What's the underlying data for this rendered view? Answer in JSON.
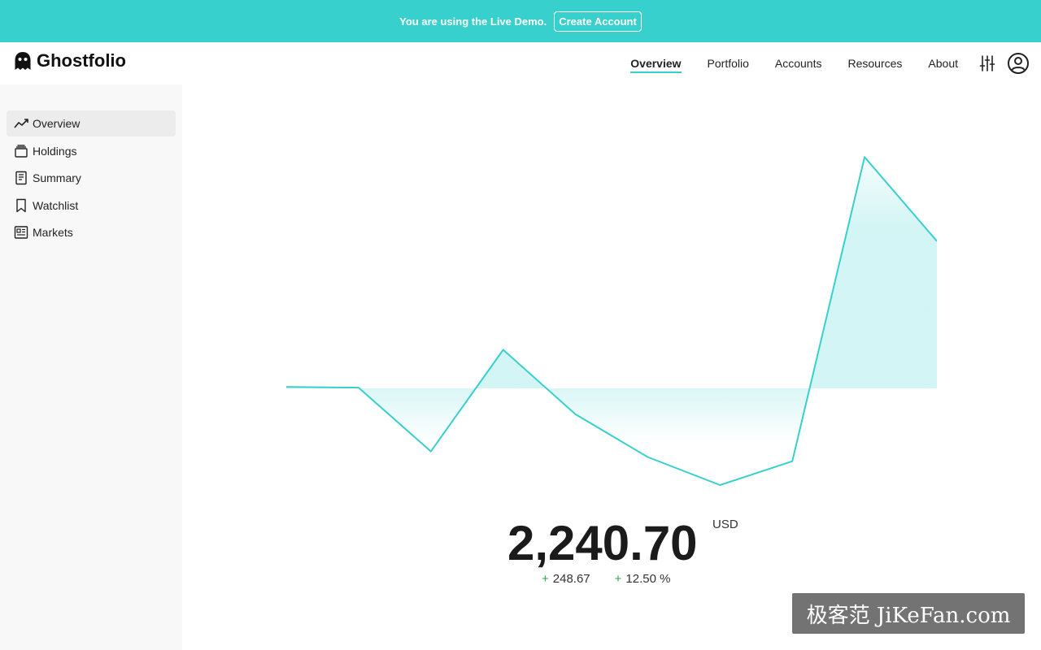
{
  "banner": {
    "text": "You are using the Live Demo.",
    "button_label": "Create Account"
  },
  "brand": {
    "name": "Ghostfolio"
  },
  "nav": {
    "items": [
      {
        "label": "Overview",
        "active": true
      },
      {
        "label": "Portfolio"
      },
      {
        "label": "Accounts"
      },
      {
        "label": "Resources"
      },
      {
        "label": "About"
      }
    ]
  },
  "sidebar": {
    "items": [
      {
        "label": "Overview",
        "icon": "trend-icon",
        "active": true
      },
      {
        "label": "Holdings",
        "icon": "holdings-icon"
      },
      {
        "label": "Summary",
        "icon": "document-icon"
      },
      {
        "label": "Watchlist",
        "icon": "bookmark-icon"
      },
      {
        "label": "Markets",
        "icon": "newspaper-icon"
      }
    ]
  },
  "performance": {
    "value": "2,240.70",
    "currency": "USD",
    "change_abs": "248.67",
    "change_pct": "12.50 %",
    "change_sign": "+"
  },
  "chart_data": {
    "type": "area",
    "values": [
      0.02,
      0.01,
      -0.9,
      0.55,
      -0.37,
      -0.98,
      -1.38,
      -1.04,
      3.3,
      2.1
    ],
    "baseline": 0,
    "ylim": [
      -1.6,
      3.5
    ],
    "line_color": "#37d0cd"
  },
  "watermark": {
    "text": "极客范 JiKeFan.com"
  },
  "colors": {
    "accent": "#37d0cd",
    "positive": "#2fa34a"
  }
}
